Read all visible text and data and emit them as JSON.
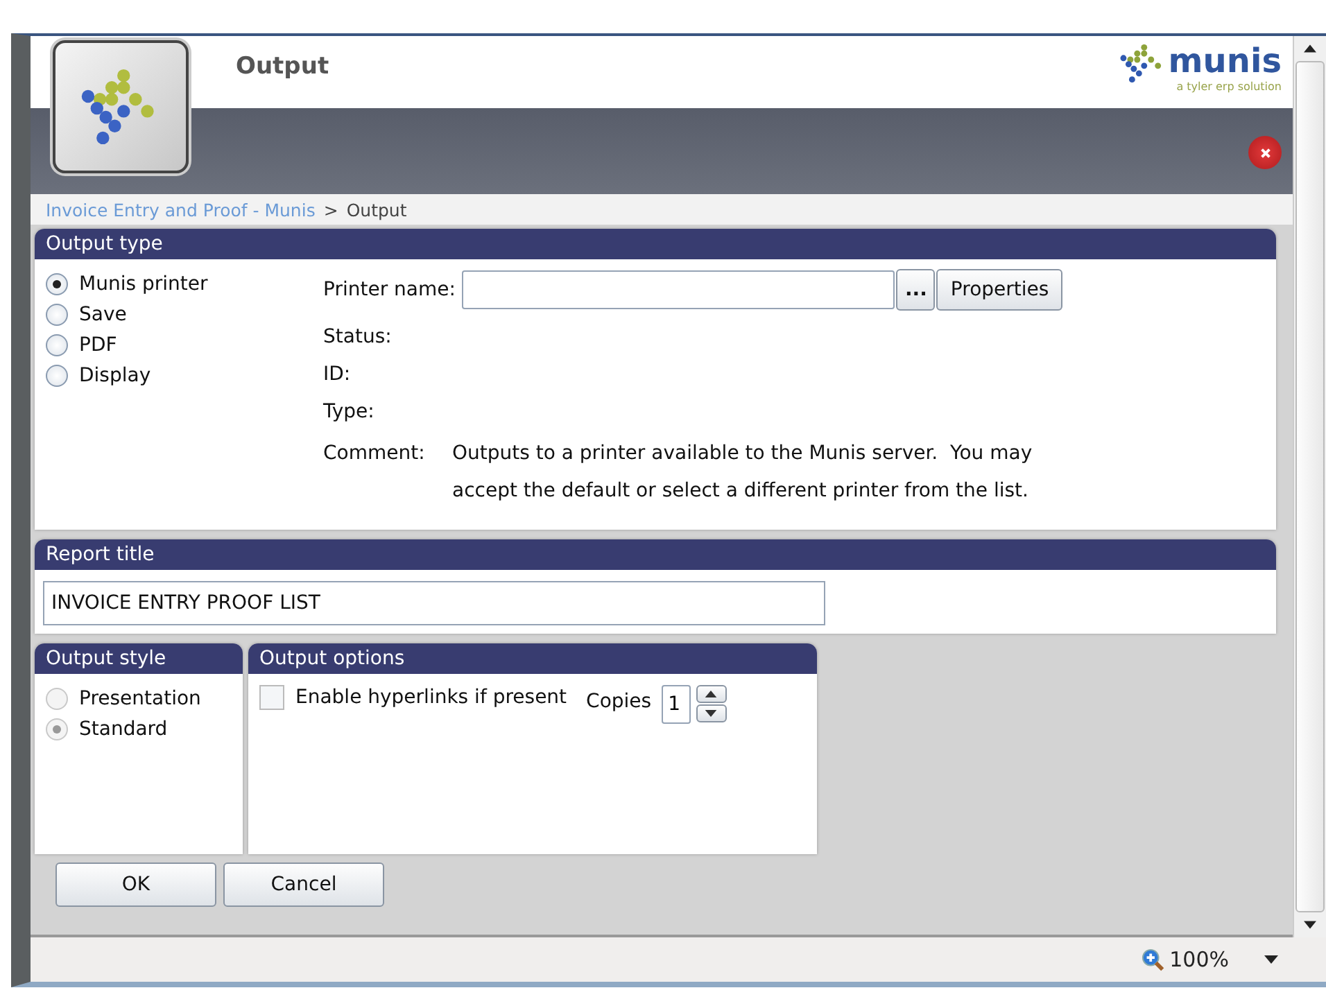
{
  "window": {
    "title": "Output",
    "brand": {
      "name": "munis",
      "tagline": "a tyler erp solution"
    }
  },
  "breadcrumb": {
    "link": "Invoice Entry and Proof - Munis",
    "separator": ">",
    "current": "Output"
  },
  "output_type": {
    "title": "Output type",
    "options": [
      {
        "label": "Munis printer",
        "selected": true
      },
      {
        "label": "Save",
        "selected": false
      },
      {
        "label": "PDF",
        "selected": false
      },
      {
        "label": "Display",
        "selected": false
      }
    ],
    "printer_label": "Printer name:",
    "browse_button": "...",
    "properties_button": "Properties",
    "details": [
      {
        "label": "Status:"
      },
      {
        "label": "ID:"
      },
      {
        "label": "Type:"
      }
    ],
    "comment": {
      "label": "Comment:",
      "lines": [
        "Outputs to a printer available to the Munis server.  You may",
        "accept the default or select a different printer from the list."
      ]
    }
  },
  "report_title": {
    "title": "Report title",
    "value": "INVOICE ENTRY PROOF LIST"
  },
  "output_style": {
    "title": "Output style",
    "options": [
      {
        "label": "Presentation",
        "selected": false,
        "disabled": true
      },
      {
        "label": "Standard",
        "selected": true,
        "disabled": true
      }
    ]
  },
  "output_options": {
    "title": "Output options",
    "hyperlinks": {
      "label": "Enable hyperlinks if present",
      "checked": false,
      "disabled": true
    },
    "copies": {
      "label": "Copies",
      "value": "1"
    }
  },
  "buttons": [
    "OK",
    "Cancel"
  ],
  "status_bar": {
    "zoom": "100%"
  }
}
